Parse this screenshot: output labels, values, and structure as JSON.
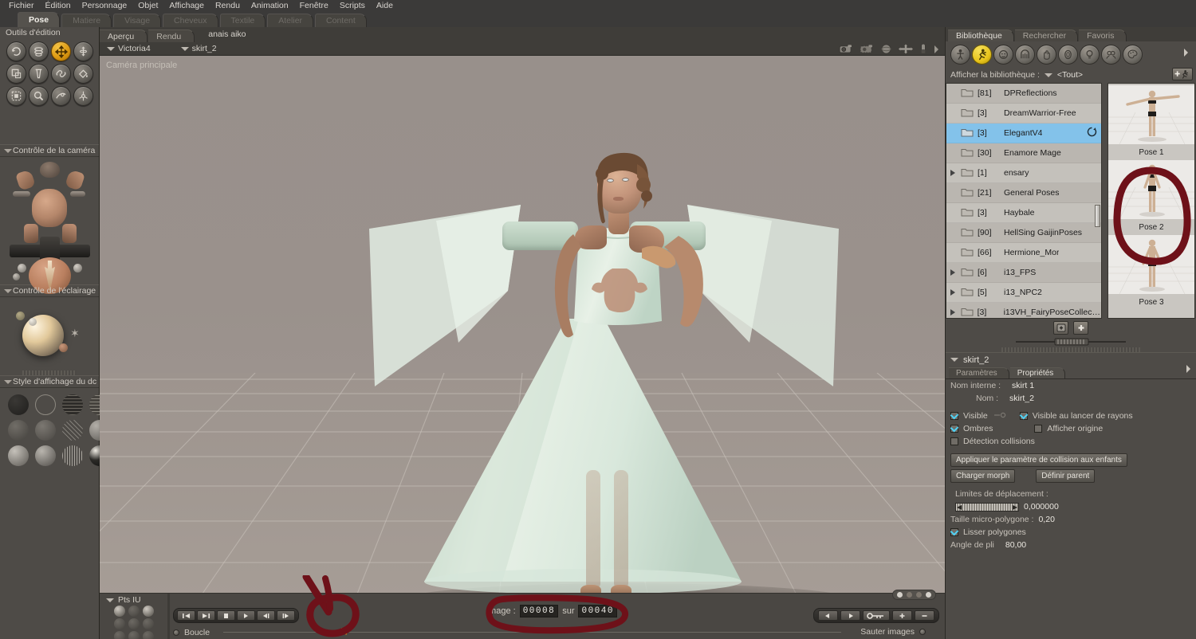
{
  "app": {
    "menu": [
      "Fichier",
      "Édition",
      "Personnage",
      "Objet",
      "Affichage",
      "Rendu",
      "Animation",
      "Fenêtre",
      "Scripts",
      "Aide"
    ],
    "room_tabs": [
      {
        "label": "Pose",
        "active": true
      },
      {
        "label": "Matiere",
        "active": false
      },
      {
        "label": "Visage",
        "active": false
      },
      {
        "label": "Cheveux",
        "active": false
      },
      {
        "label": "Textile",
        "active": false
      },
      {
        "label": "Atelier",
        "active": false
      },
      {
        "label": "Content",
        "active": false
      }
    ]
  },
  "left_panel": {
    "edit_tools_title": "Outils d'édition",
    "edit_tools": [
      {
        "name": "rotate-tool",
        "selected": false
      },
      {
        "name": "twist-tool",
        "selected": false
      },
      {
        "name": "translate-pull-tool",
        "selected": true
      },
      {
        "name": "translate-inout-tool",
        "selected": false
      },
      {
        "name": "scale-tool",
        "selected": false
      },
      {
        "name": "taper-tool",
        "selected": false
      },
      {
        "name": "chain-break-tool",
        "selected": false
      },
      {
        "name": "color-tool",
        "selected": false
      },
      {
        "name": "grouping-tool",
        "selected": false
      },
      {
        "name": "view-magnifier-tool",
        "selected": false
      },
      {
        "name": "morph-putty-tool",
        "selected": false
      },
      {
        "name": "direct-manipulation-tool",
        "selected": false
      }
    ],
    "camera_title": "Contrôle de la caméra",
    "light_title": "Contrôle de l'éclairage",
    "style_title": "Style d'affichage du dc",
    "display_styles": [
      "silhouette",
      "outline",
      "wireframe",
      "hidden-line",
      "lit-wireframe",
      "flat-shaded",
      "flat-lined",
      "smooth-shaded",
      "smooth-lined",
      "texture-shaded",
      "texture-lined",
      "cartoon"
    ]
  },
  "viewport": {
    "tabs": [
      {
        "label": "Aperçu",
        "active": true
      },
      {
        "label": "Rendu",
        "active": false
      }
    ],
    "scene_name": "anais aiko",
    "figure_select": "Victoria4",
    "part_select": "skirt_2",
    "camera_label": "Caméra principale",
    "top_icons": [
      "camera-icon",
      "camera-dashed-icon",
      "sphere-icon",
      "move-cross-icon",
      "light-icon",
      "expand-arrow-icon"
    ],
    "bottom_icons": [
      "chevron-down-icon",
      "square-icon",
      "chevron-down-icon-2",
      "sphere-half-icon",
      "spheres-icon",
      "shaded-sphere-icon"
    ],
    "page_dots": [
      true,
      false,
      false,
      true
    ]
  },
  "library": {
    "tabs": [
      {
        "label": "Bibliothèque",
        "active": true
      },
      {
        "label": "Rechercher",
        "active": false
      },
      {
        "label": "Favoris",
        "active": false
      }
    ],
    "categories": [
      {
        "name": "figures-icon",
        "selected": false
      },
      {
        "name": "poses-icon",
        "selected": true
      },
      {
        "name": "faces-icon",
        "selected": false
      },
      {
        "name": "hair-icon",
        "selected": false
      },
      {
        "name": "hands-icon",
        "selected": false
      },
      {
        "name": "props-icon",
        "selected": false
      },
      {
        "name": "lights-icon",
        "selected": false
      },
      {
        "name": "cameras-icon",
        "selected": false
      },
      {
        "name": "materials-icon",
        "selected": false
      }
    ],
    "filter_label": "Afficher la bibliothèque :",
    "filter_value": "<Tout>",
    "add_button": "add-runtime-button",
    "folders": [
      {
        "count": "[81]",
        "name": "DPReflections",
        "expandable": false,
        "selected": false
      },
      {
        "count": "[3]",
        "name": "DreamWarrior-Free",
        "expandable": false,
        "selected": false
      },
      {
        "count": "[3]",
        "name": "ElegantV4",
        "expandable": false,
        "selected": true,
        "loading": true
      },
      {
        "count": "[30]",
        "name": "Enamore Mage",
        "expandable": false,
        "selected": false
      },
      {
        "count": "[1]",
        "name": "ensary",
        "expandable": true,
        "selected": false
      },
      {
        "count": "[21]",
        "name": "General Poses",
        "expandable": false,
        "selected": false
      },
      {
        "count": "[3]",
        "name": "Haybale",
        "expandable": false,
        "selected": false
      },
      {
        "count": "[90]",
        "name": "HellSing GaijinPoses",
        "expandable": false,
        "selected": false
      },
      {
        "count": "[66]",
        "name": "Hermione_Mor",
        "expandable": false,
        "selected": false
      },
      {
        "count": "[6]",
        "name": "i13_FPS",
        "expandable": true,
        "selected": false
      },
      {
        "count": "[5]",
        "name": "i13_NPC2",
        "expandable": true,
        "selected": false
      },
      {
        "count": "[3]",
        "name": "i13VH_FairyPoseCollection",
        "expandable": true,
        "selected": false
      }
    ],
    "thumbnails": [
      {
        "label": "Pose 1",
        "highlighted": false
      },
      {
        "label": "Pose 2",
        "highlighted": true
      },
      {
        "label": "Pose 3",
        "highlighted": false
      }
    ]
  },
  "properties": {
    "object_name": "skirt_2",
    "tabs": [
      {
        "label": "Paramètres",
        "active": false
      },
      {
        "label": "Propriétés",
        "active": true
      }
    ],
    "internal_name_label": "Nom interne :",
    "internal_name_value": "skirt 1",
    "name_label": "Nom :",
    "name_value": "skirt_2",
    "checkboxes": [
      {
        "label": "Visible",
        "checked": true
      },
      {
        "label": "Visible au lancer de rayons",
        "checked": true
      },
      {
        "label": "Ombres",
        "checked": true
      },
      {
        "label": "Afficher origine",
        "checked": false
      },
      {
        "label": "Détection collisions",
        "checked": false
      }
    ],
    "apply_collision_button": "Appliquer le paramètre de collision aux enfants",
    "load_morph_button": "Charger morph",
    "set_parent_button": "Définir parent",
    "displacement_label": "Limites de déplacement :",
    "displacement_value": "0,000000",
    "micropoly_label": "Taille micro-polygone :",
    "micropoly_value": "0,20",
    "smooth_label": "Lisser polygones",
    "smooth_checked": true,
    "crease_label": "Angle de pli",
    "crease_value": "80,00"
  },
  "animation": {
    "ptsiu_label": "Pts IU",
    "transport": [
      "skip-start-icon",
      "skip-end-icon",
      "stop-icon",
      "play-icon",
      "step-back-icon",
      "step-forward-icon"
    ],
    "loop_label": "Boucle",
    "frame_label": "Image :",
    "frame_current": "00008",
    "frame_of": "sur",
    "frame_total": "00040",
    "keys": [
      "prev-key-icon",
      "next-key-icon",
      "key-icon",
      "add-key-icon",
      "remove-key-icon"
    ],
    "skip_label": "Sauter images"
  },
  "colors": {
    "accent_orange": "#e8a81c",
    "accent_yellow": "#e8c41b",
    "selection_blue": "#83c2ea",
    "annotation_red": "#6e1119",
    "panel_bg": "#4e4b47",
    "viewport_bg": "#9a918c",
    "dress": "#d4e6da"
  }
}
